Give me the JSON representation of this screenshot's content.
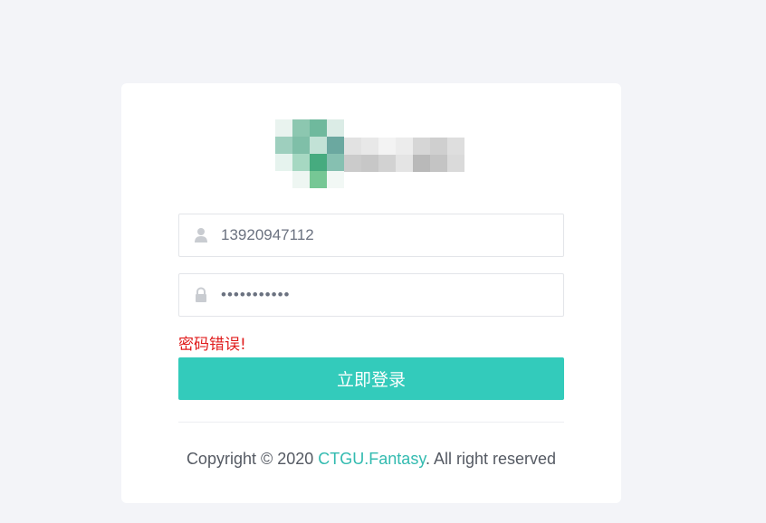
{
  "login": {
    "username_value": "13920947112",
    "password_value": "•••••••••••",
    "error_message": "密码错误!",
    "submit_label": "立即登录"
  },
  "logo": {
    "icon": "pixelated-logo-icon"
  },
  "footer": {
    "copyright_prefix": "Copyright © 2020 ",
    "brand_link": "CTGU.Fantasy",
    "copyright_suffix": ". All right reserved"
  },
  "colors": {
    "accent": "#33cbbb",
    "link": "#33bbb0",
    "error": "#e01b1b",
    "page_bg": "#f3f4f8"
  },
  "icons": {
    "username": "user-icon",
    "password": "lock-icon"
  }
}
